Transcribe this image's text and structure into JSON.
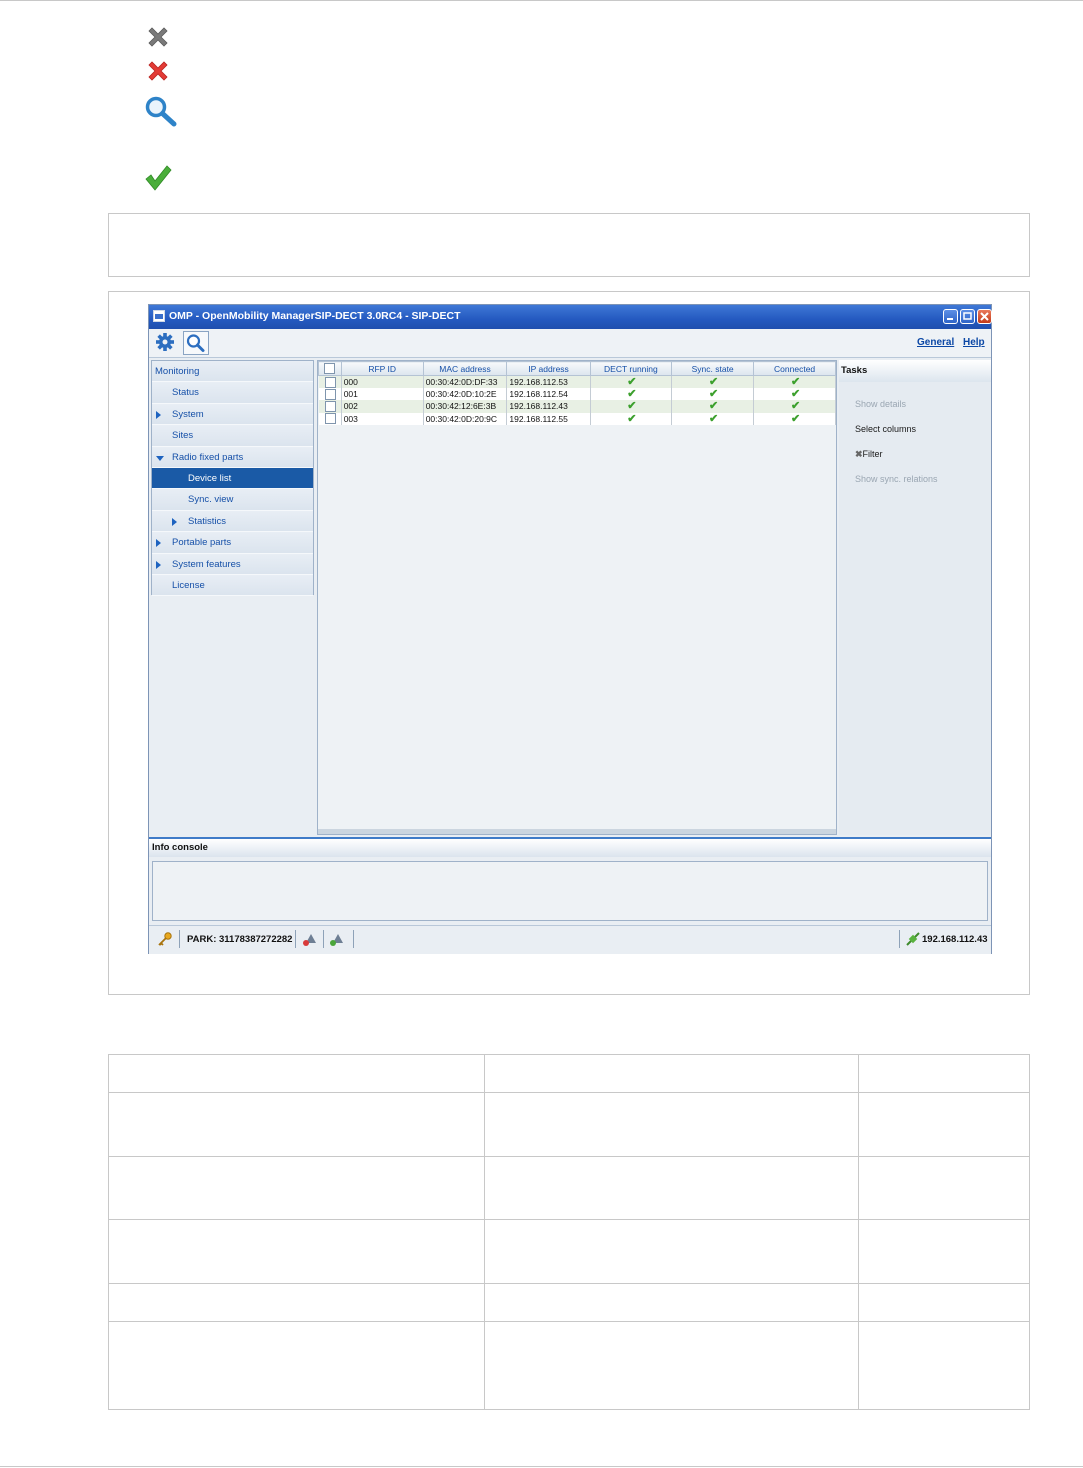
{
  "legend_icons": [
    {
      "icon": "gray-x-icon",
      "color": "#7a7a7a"
    },
    {
      "icon": "red-x-icon",
      "color": "#e02b2b"
    },
    {
      "icon": "magnifier-icon",
      "color": "#2e83c8"
    },
    {
      "icon": "green-check-icon",
      "color": "#4aae3a"
    }
  ],
  "window": {
    "title": "OMP - OpenMobility ManagerSIP-DECT 3.0RC4 - SIP-DECT",
    "menu_general": "General",
    "menu_help": "Help"
  },
  "sidebar": {
    "items": [
      {
        "label": "Monitoring",
        "indent": 0,
        "arrow": "none"
      },
      {
        "label": "Status",
        "indent": 1,
        "arrow": "none"
      },
      {
        "label": "System",
        "indent": 1,
        "arrow": "right"
      },
      {
        "label": "Sites",
        "indent": 1,
        "arrow": "none"
      },
      {
        "label": "Radio fixed parts",
        "indent": 1,
        "arrow": "down"
      },
      {
        "label": "Device list",
        "indent": 2,
        "arrow": "none",
        "selected": true
      },
      {
        "label": "Sync. view",
        "indent": 2,
        "arrow": "none"
      },
      {
        "label": "Statistics",
        "indent": 2,
        "arrow": "right"
      },
      {
        "label": "Portable parts",
        "indent": 1,
        "arrow": "right"
      },
      {
        "label": "System features",
        "indent": 1,
        "arrow": "right"
      },
      {
        "label": "License",
        "indent": 1,
        "arrow": "none"
      }
    ]
  },
  "device_table": {
    "columns": [
      "RFP ID",
      "MAC address",
      "IP address",
      "DECT running",
      "Sync. state",
      "Connected"
    ],
    "rows": [
      {
        "rfp_id": "000",
        "mac": "00:30:42:0D:DF:33",
        "ip": "192.168.112.53"
      },
      {
        "rfp_id": "001",
        "mac": "00:30:42:0D:10:2E",
        "ip": "192.168.112.54"
      },
      {
        "rfp_id": "002",
        "mac": "00:30:42:12:6E:3B",
        "ip": "192.168.112.43"
      },
      {
        "rfp_id": "003",
        "mac": "00:30:42:0D:20:9C",
        "ip": "192.168.112.55"
      }
    ],
    "check_glyph": "✔"
  },
  "tasks": {
    "title": "Tasks",
    "items": [
      {
        "label": "Show details",
        "enabled": false
      },
      {
        "label": "Select columns",
        "enabled": true
      },
      {
        "label": "Filter",
        "enabled": true
      },
      {
        "label": "Show sync. relations",
        "enabled": false
      }
    ]
  },
  "info_console": {
    "title": "Info console"
  },
  "status_bar": {
    "park": "PARK: 31178387272282",
    "address": "192.168.112.43"
  }
}
